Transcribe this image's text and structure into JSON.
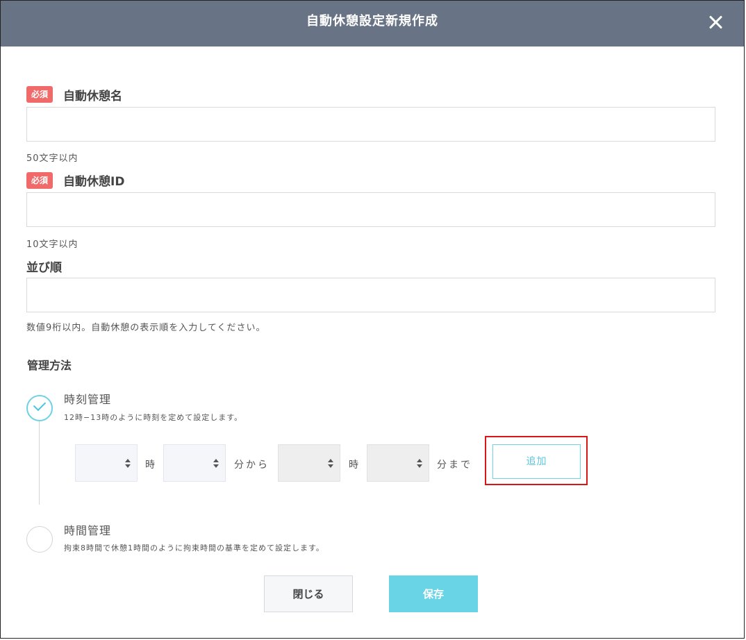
{
  "header": {
    "title": "自動休憩設定新規作成"
  },
  "fields": [
    {
      "required": "必須",
      "label": "自動休憩名",
      "value": "",
      "placeholder": "",
      "help": "50文字以内"
    },
    {
      "required": "必須",
      "label": "自動休憩ID",
      "value": "",
      "placeholder": "",
      "help": "10文字以内"
    },
    {
      "label": "並び順",
      "value": "",
      "placeholder": "",
      "help": "数値9桁以内。自動休憩の表示順を入力してください。"
    }
  ],
  "management": {
    "title": "管理方法",
    "options": [
      {
        "label": "時刻管理",
        "description": "12時−13時のように時刻を定めて設定します。",
        "selected": true
      },
      {
        "label": "時間管理",
        "description": "拘束8時間で休憩1時間のように拘束時間の基準を定めて設定します。",
        "selected": false
      }
    ],
    "time_row": {
      "from_hour": "",
      "from_minute": "",
      "to_hour": "",
      "to_minute": "",
      "unit_hour": "時",
      "unit_minute_from": "分から",
      "unit_hour2": "時",
      "unit_minute_to": "分まで",
      "add_label": "追加"
    }
  },
  "footer": {
    "close_label": "閉じる",
    "save_label": "保存"
  },
  "colors": {
    "header": "#687485",
    "required": "#f06a6a",
    "accent": "#69d4e6",
    "highlight": "#d91515"
  },
  "icons": {
    "close": "close-icon",
    "check": "check-icon",
    "select": "select-arrows-icon"
  }
}
